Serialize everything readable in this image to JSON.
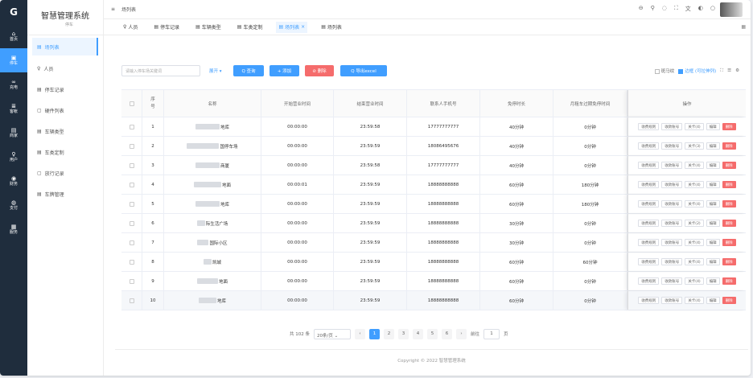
{
  "rail": {
    "logo": "G",
    "items": [
      {
        "icon": "⌂",
        "label": "首页"
      },
      {
        "icon": "▣",
        "label": "停车"
      },
      {
        "icon": "∞",
        "label": "充电"
      },
      {
        "icon": "≣",
        "label": "客帐"
      },
      {
        "icon": "▤",
        "label": "商家"
      },
      {
        "icon": "♀",
        "label": "用户"
      },
      {
        "icon": "◉",
        "label": "财务"
      },
      {
        "icon": "◍",
        "label": "支付"
      },
      {
        "icon": "▦",
        "label": "服务"
      }
    ]
  },
  "sidebar": {
    "title": "智慧管理系统",
    "subtitle": "停车",
    "items": [
      {
        "icon": "▤",
        "label": "场列表"
      },
      {
        "icon": "♀",
        "label": "人员"
      },
      {
        "icon": "▤",
        "label": "停车记录"
      },
      {
        "icon": "▢",
        "label": "硬件列表"
      },
      {
        "icon": "▤",
        "label": "车辆类型"
      },
      {
        "icon": "▤",
        "label": "车类定制"
      },
      {
        "icon": "▢",
        "label": "放行记录"
      },
      {
        "icon": "▤",
        "label": "车牌管理"
      }
    ]
  },
  "topbar": {
    "collapse_icon": "≡",
    "breadcrumb": "场列表",
    "icons": [
      "lock-icon",
      "search-icon",
      "bell-icon",
      "fullscreen-icon",
      "translate-icon",
      "theme-icon",
      "github-icon"
    ]
  },
  "tabs": [
    {
      "icon": "♀",
      "label": "人员"
    },
    {
      "icon": "▤",
      "label": "停车记录"
    },
    {
      "icon": "▤",
      "label": "车辆类型"
    },
    {
      "icon": "▤",
      "label": "车类定制"
    },
    {
      "icon": "▤",
      "label": "场列表",
      "close": "×"
    },
    {
      "icon": "▤",
      "label": "场列表"
    }
  ],
  "toolbar": {
    "search_placeholder": "请输入停车场关键词",
    "expand": "展开",
    "query": "Q 查询",
    "add": "+ 添加",
    "delete": "⊘ 删除",
    "export": "Q 导出excel",
    "opt_zebra": "斑马纹",
    "opt_border": "边框 (可拉伸列)"
  },
  "table": {
    "headers": [
      "序号",
      "名称",
      "开始营业时间",
      "结束营业时间",
      "联系人手机号",
      "免停时长",
      "月租车过期免停时间",
      "操作"
    ],
    "rows": [
      [
        "1",
        "地库",
        "00:00:00",
        "23:59:58",
        "17777777777",
        "40分钟",
        "0分钟"
      ],
      [
        "2",
        "国停车场",
        "00:00:00",
        "23:59:59",
        "18086495676",
        "40分钟",
        "0分钟"
      ],
      [
        "3",
        "商厦",
        "00:00:00",
        "23:59:58",
        "17777777777",
        "40分钟",
        "0分钟"
      ],
      [
        "4",
        "地面",
        "00:00:01",
        "23:59:59",
        "18888888888",
        "60分钟",
        "180分钟"
      ],
      [
        "5",
        "地库",
        "00:00:00",
        "23:59:59",
        "18888888888",
        "60分钟",
        "180分钟"
      ],
      [
        "6",
        "际生活广场",
        "00:00:00",
        "23:59:59",
        "18888888888",
        "30分钟",
        "0分钟"
      ],
      [
        "7",
        "国际小区",
        "00:00:00",
        "23:59:59",
        "18888888888",
        "30分钟",
        "0分钟"
      ],
      [
        "8",
        "凯城",
        "00:00:00",
        "23:59:59",
        "18888888888",
        "60分钟",
        "60分钟"
      ],
      [
        "9",
        "地面",
        "00:00:00",
        "23:59:59",
        "18888888888",
        "60分钟",
        "0分钟"
      ],
      [
        "10",
        "地库",
        "00:00:00",
        "23:59:59",
        "18888888888",
        "60分钟",
        "0分钟"
      ]
    ],
    "ops": [
      [
        "收费规则",
        "收款账号",
        "关卡(4)",
        "编辑",
        "删除"
      ],
      [
        "收费规则",
        "收款账号",
        "关卡(3)",
        "编辑",
        "删除"
      ],
      [
        "收费规则",
        "收款账号",
        "关卡(4)",
        "编辑",
        "删除"
      ],
      [
        "收费规则",
        "收款账号",
        "关卡(4)",
        "编辑",
        "删除"
      ],
      [
        "收费规则",
        "收款账号",
        "关卡(4)",
        "编辑",
        "删除"
      ],
      [
        "收费规则",
        "收款账号",
        "关卡(2)",
        "编辑",
        "删除"
      ],
      [
        "收费规则",
        "收款账号",
        "关卡(4)",
        "编辑",
        "删除"
      ],
      [
        "收费规则",
        "收款账号",
        "关卡(4)",
        "编辑",
        "删除"
      ],
      [
        "收费规则",
        "收款账号",
        "关卡(4)",
        "编辑",
        "删除"
      ],
      [
        "收费规则",
        "收款账号",
        "关卡(4)",
        "编辑",
        "删除"
      ]
    ]
  },
  "pagination": {
    "total": "共 102 条",
    "page_size": "20条/页",
    "pages": [
      "1",
      "2",
      "3",
      "4",
      "5",
      "6"
    ],
    "current": "1",
    "goto": "前往",
    "goto_value": "1",
    "page_unit": "页"
  },
  "footer": "Copyright © 2022 智慧管理系统"
}
